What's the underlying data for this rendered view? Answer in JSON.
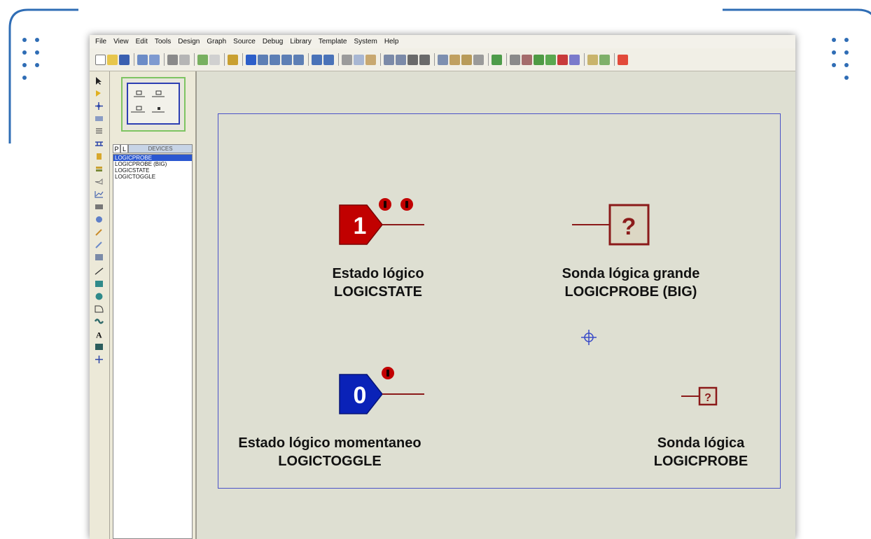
{
  "menu": [
    "File",
    "View",
    "Edit",
    "Tools",
    "Design",
    "Graph",
    "Source",
    "Debug",
    "Library",
    "Template",
    "System",
    "Help"
  ],
  "panel": {
    "tab_p": "P",
    "tab_l": "L",
    "tab_devices": "DEVICES",
    "devices": [
      "LOGICPROBE",
      "LOGICPROBE (BIG)",
      "LOGICSTATE",
      "LOGICTOGGLE"
    ],
    "selected_index": 0
  },
  "components": {
    "logicstate": {
      "symbol_text": "1",
      "title": "Estado lógico",
      "name": "LOGICSTATE"
    },
    "logicprobe_big": {
      "symbol_text": "?",
      "title": "Sonda lógica grande",
      "name": "LOGICPROBE (BIG)"
    },
    "logictoggle": {
      "symbol_text": "0",
      "title": "Estado lógico momentaneo",
      "name": "LOGICTOGGLE"
    },
    "logicprobe": {
      "symbol_text": "?",
      "title": "Sonda lógica",
      "name": "LOGICPROBE"
    }
  },
  "colors": {
    "deco_accent": "#2f6db5",
    "state_red": "#c10000",
    "toggle_blue": "#0a22b8",
    "probe_border": "#8b1a1a",
    "sheet_border": "#4a52c8",
    "canvas_bg": "#dedfd2"
  }
}
